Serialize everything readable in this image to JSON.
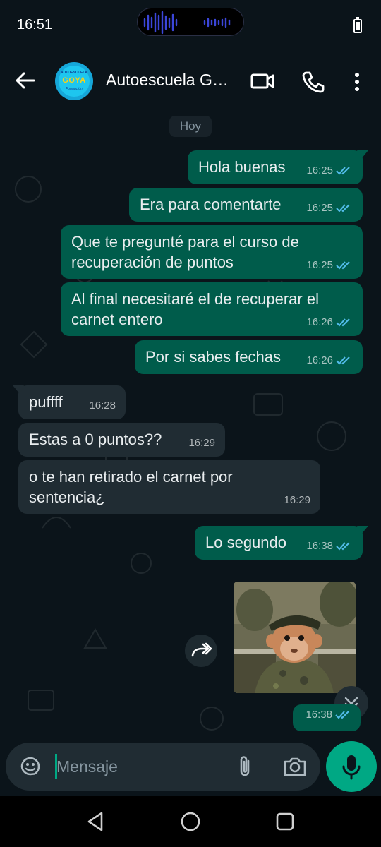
{
  "status_bar": {
    "time": "16:51"
  },
  "header": {
    "contact_name": "Autoescuela G…",
    "avatar": {
      "top_text": "AUTOESCUELA",
      "brand": "GOYA",
      "bottom_text": "Formación"
    }
  },
  "chat": {
    "day_label": "Hoy",
    "messages": [
      {
        "direction": "out",
        "text": "Hola buenas",
        "time": "16:25",
        "status": "read"
      },
      {
        "direction": "out",
        "text": "Era para comentarte",
        "time": "16:25",
        "status": "read"
      },
      {
        "direction": "out",
        "lines": [
          "Que te pregunté para el curso de",
          "recuperación de puntos"
        ],
        "time": "16:25",
        "status": "read"
      },
      {
        "direction": "out",
        "lines": [
          "Al final necesitaré el de recuperar el",
          "carnet entero"
        ],
        "time": "16:26",
        "status": "read"
      },
      {
        "direction": "out",
        "text": "Por si sabes fechas",
        "time": "16:26",
        "status": "read"
      },
      {
        "direction": "in",
        "text": "puffff",
        "time": "16:28"
      },
      {
        "direction": "in",
        "text": "Estas a 0 puntos??",
        "time": "16:29"
      },
      {
        "direction": "in",
        "lines": [
          "o te han retirado el carnet por",
          "sentencia¿"
        ],
        "time": "16:29"
      },
      {
        "direction": "out",
        "text": "Lo segundo",
        "time": "16:38",
        "status": "read"
      },
      {
        "direction": "out",
        "type": "image",
        "image_icon": "monkey-soldier-image",
        "time": "16:38",
        "status": "read"
      }
    ]
  },
  "composer": {
    "placeholder": "Mensaje"
  },
  "icons": {
    "back": "arrow-left-icon",
    "video": "video-camera-icon",
    "call": "phone-icon",
    "more": "more-vertical-icon",
    "emoji": "sticker-icon",
    "attach": "paperclip-icon",
    "camera": "camera-icon",
    "mic": "microphone-icon",
    "forward": "forward-icon",
    "scroll": "double-chevron-down-icon"
  },
  "colors": {
    "background": "#0b141a",
    "outgoing_bubble": "#005c4b",
    "incoming_bubble": "#202c33",
    "read_tick": "#53bdeb",
    "accent": "#00a884"
  }
}
